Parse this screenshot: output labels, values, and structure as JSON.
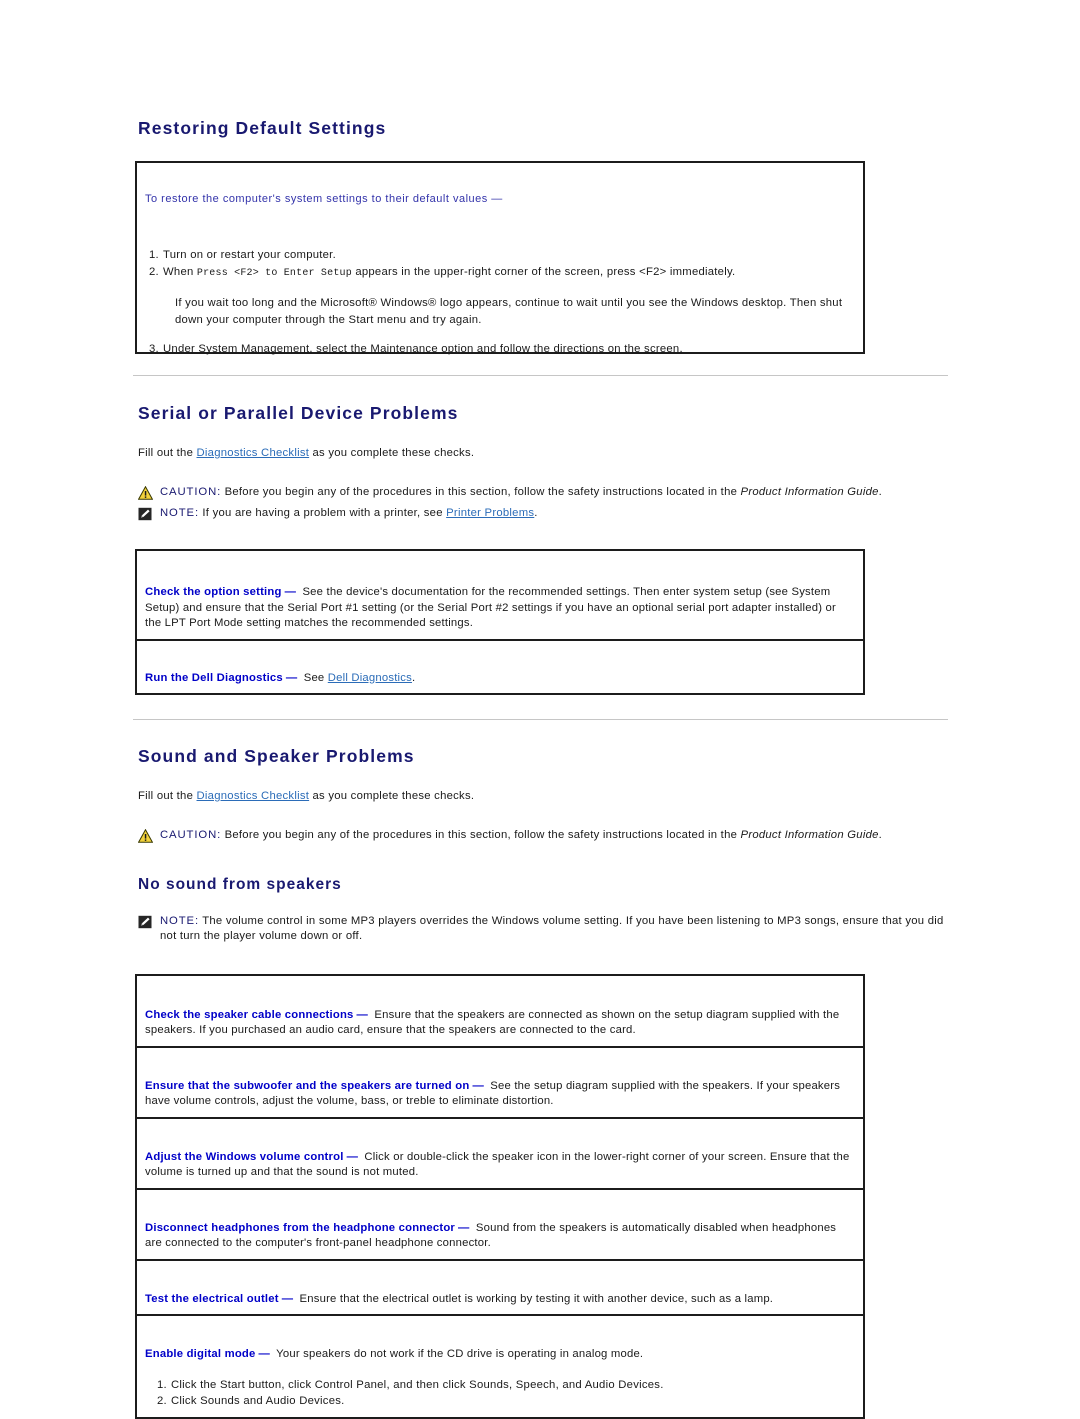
{
  "colors": {
    "heading": "#191970",
    "link": "#2b6cb8",
    "check_label": "#0000c8",
    "caution_icon": "#f2d23c",
    "note_icon": "#262626",
    "rule": "#c6c6c6",
    "box_border": "#1c1c1c"
  },
  "sections": {
    "restoring": {
      "title": "Restoring Default Settings",
      "intro": "To restore the computer's system settings to their default values —",
      "steps": [
        {
          "num": "1.",
          "pre": "Turn on or restart your computer.",
          "mono": "",
          "post": ""
        },
        {
          "num": "2.",
          "pre": "When ",
          "mono": "Press <F2> to Enter Setup",
          "post": " appears in the upper-right corner of the screen, press <F2> immediately."
        }
      ],
      "note_paragraph": "If you wait too long and the Microsoft® Windows® logo appears, continue to wait until you see the Windows desktop. Then shut down your computer through the Start menu and try again.",
      "step3": {
        "num": "3.",
        "text": "Under System Management, select the Maintenance option and follow the directions on the screen."
      }
    },
    "serial_parallel": {
      "title": "Serial or Parallel Device Problems",
      "fill_out_pre": "Fill out the ",
      "fill_out_link": "Diagnostics Checklist",
      "fill_out_post": " as you complete these checks.",
      "caution": {
        "label": "CAUTION:",
        "text_before": " Before you begin any of the procedures in this section, follow the safety instructions located in the ",
        "italic": "Product Information Guide",
        "text_after": "."
      },
      "note": {
        "label": "NOTE:",
        "text_before": " If you are having a problem with a printer, see ",
        "link": "Printer Problems",
        "text_after": "."
      },
      "checks": [
        {
          "label": "Check the option setting",
          "dash": "—",
          "text": " See the device's documentation for the recommended settings. Then enter system setup (see System Setup) and ensure that the Serial Port #1 setting (or the Serial Port #2 settings if you have an optional serial port adapter installed) or the LPT Port Mode setting matches the recommended settings."
        },
        {
          "label": "Run the Dell Diagnostics",
          "dash": "—",
          "text": " See ",
          "link": "Dell Diagnostics",
          "text_after": "."
        }
      ]
    },
    "sound_speaker": {
      "title": "Sound and Speaker Problems",
      "fill_out_pre": "Fill out the ",
      "fill_out_link": "Diagnostics Checklist",
      "fill_out_post": " as you complete these checks.",
      "caution": {
        "label": "CAUTION:",
        "text_before": " Before you begin any of the procedures in this section, follow the safety instructions located in the ",
        "italic": "Product Information Guide",
        "text_after": "."
      },
      "subsection_title": "No sound from speakers",
      "note": {
        "label": "NOTE:",
        "text": " The volume control in some MP3 players overrides the Windows volume setting. If you have been listening to MP3 songs, ensure that you did not turn the player volume down or off."
      },
      "checks": [
        {
          "label": "Check the speaker cable connections",
          "dash": "—",
          "text": " Ensure that the speakers are connected as shown on the setup diagram supplied with the speakers. If you purchased an audio card, ensure that the speakers are connected to the card."
        },
        {
          "label": "Ensure that the subwoofer and the speakers are turned on",
          "dash": "—",
          "text": " See the setup diagram supplied with the speakers. If your speakers have volume controls, adjust the volume, bass, or treble to eliminate distortion."
        },
        {
          "label": "Adjust the Windows volume control",
          "dash": "—",
          "text": " Click or double-click the speaker icon in the lower-right corner of your screen. Ensure that the volume is turned up and that the sound is not muted."
        },
        {
          "label": "Disconnect headphones from the headphone connector",
          "dash": "—",
          "text": " Sound from the speakers is automatically disabled when headphones are connected to the computer's front-panel headphone connector."
        },
        {
          "label": "Test the electrical outlet",
          "dash": "—",
          "text": " Ensure that the electrical outlet is working by testing it with another device, such as a lamp."
        },
        {
          "label": "Enable digital mode",
          "dash": "—",
          "text": " Your speakers do not work if the CD drive is operating in analog mode.",
          "steps": [
            {
              "num": "1.",
              "text": "Click the Start button, click Control Panel, and then click Sounds, Speech, and Audio Devices."
            },
            {
              "num": "2.",
              "text": "Click Sounds and Audio Devices."
            }
          ]
        }
      ]
    }
  }
}
